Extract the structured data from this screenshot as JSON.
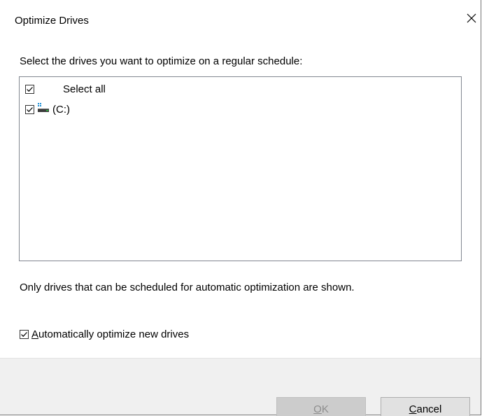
{
  "window": {
    "title": "Optimize Drives",
    "close_icon": "close-icon"
  },
  "instruction": "Select the drives you want to optimize on a regular schedule:",
  "drive_list": {
    "items": [
      {
        "label": "Select all",
        "checked": true
      },
      {
        "label": "(C:)",
        "checked": true,
        "icon": "drive-icon"
      }
    ]
  },
  "note": "Only drives that can be scheduled for automatic optimization are shown.",
  "auto_optimize": {
    "label_mnemonic": "A",
    "label_rest": "utomatically optimize new drives",
    "checked": true
  },
  "buttons": {
    "ok_mnemonic": "O",
    "ok_rest": "K",
    "ok_enabled": false,
    "cancel_mnemonic": "C",
    "cancel_rest": "ancel"
  },
  "colors": {
    "footer_bg": "#f0f0f0",
    "drive_icon_blue": "#1e90d6",
    "drive_icon_body": "#3c3c3c",
    "drive_icon_led": "#2fbf3f"
  }
}
